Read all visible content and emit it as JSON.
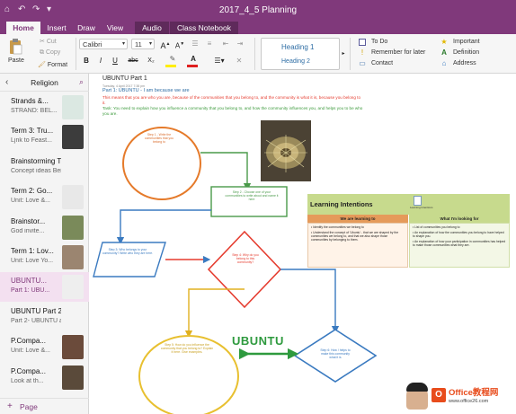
{
  "window": {
    "title": "2017_4_5 Planning"
  },
  "tabs": [
    "Home",
    "Insert",
    "Draw",
    "View",
    "Audio",
    "Class Notebook"
  ],
  "ribbon": {
    "paste": "Paste",
    "cut": "Cut",
    "copy": "Copy",
    "format": "Format",
    "font": "Calibri",
    "size": "11",
    "bold": "B",
    "italic": "I",
    "underline": "U",
    "strike": "abc",
    "subscript": "X₂",
    "font_color": "A",
    "heading1": "Heading 1",
    "heading2": "Heading 2",
    "tags": [
      "To Do",
      "Remember for later",
      "Contact",
      "Important",
      "Definition",
      "Address"
    ]
  },
  "sidebar": {
    "notebook": "Religion",
    "add_page": "Page",
    "pages": [
      {
        "title": "Strands &...",
        "sub": "STRAND: BEL...",
        "thumb": "#dbe8e2"
      },
      {
        "title": "Term 3: Tru...",
        "sub": "Ljnk to Feast...",
        "thumb": "#3c3c3c"
      },
      {
        "title": "Brainstorming T...",
        "sub": "Concept ideas  Bei...",
        "thumb": ""
      },
      {
        "title": "Term 2: Go...",
        "sub": "Unit: Love &...",
        "thumb": "#e8e8e8"
      },
      {
        "title": "Brainstor...",
        "sub": "God invite...",
        "thumb": "#7a8a5a"
      },
      {
        "title": "Term 1: Lov...",
        "sub": "Unit: Love Yo...",
        "thumb": "#9b8570"
      },
      {
        "title": "UBUNTU...",
        "sub": "Part 1: UBU...",
        "thumb": "#eeeeee"
      },
      {
        "title": "UBUNTU Part 2",
        "sub": "Part 2- UBUNTU a...",
        "thumb": ""
      },
      {
        "title": "P.Compa...",
        "sub": "Unit: Love &...",
        "thumb": "#6b4b3b"
      },
      {
        "title": "P.Compa...",
        "sub": "Look at th...",
        "thumb": "#5a4a3a"
      }
    ]
  },
  "page": {
    "title": "UBUNTU Part 1",
    "date": "Tuesday, 4 April 2017     7:38 pm",
    "heading": "Part 1: UBUNTU - I am because we are",
    "line_red": "This means that you are who you are, because of the communities that you belong to, and the community is what it is, because you belong to it.",
    "line_green": "Task: You need to explain how you influence a community that you belong to, and how the community influences you, and helps you to be who you are.",
    "ubuntu": "UBUNTU",
    "step1": "Step 1 - Write the communities that you belong to",
    "step2": "Step 2 - Choose one of your communities to write about and name it here",
    "step3": "Step 3: Who belongs to your community? Write who they are here.",
    "step4": "Step 4: Why do you belong to this community?",
    "step5": "Step 5: How do you influence the community that you belong to? Explain it here. Give examples.",
    "step6": "Step 6: How / helps to make this community what it is"
  },
  "learning": {
    "title": "Learning Intentions",
    "file_label": "Learning Intentions",
    "col1": "We are learning to",
    "col2": "What I'm looking for",
    "col1_items": [
      "Identify the communities we belong to",
      "Understand the concept of 'Ubuntu' - that we are shaped by the communities we belong to, and that we also shape those communities by belonging to them."
    ],
    "col2_items": [
      "List of communities you belong to",
      "An explanation of how the communities you belong to have helped to shape you.",
      "An explanation of how your participation in communities has helped to make those communities what they are."
    ]
  },
  "watermark": {
    "line1": "Office教程网",
    "line2": "www.office26.com"
  }
}
